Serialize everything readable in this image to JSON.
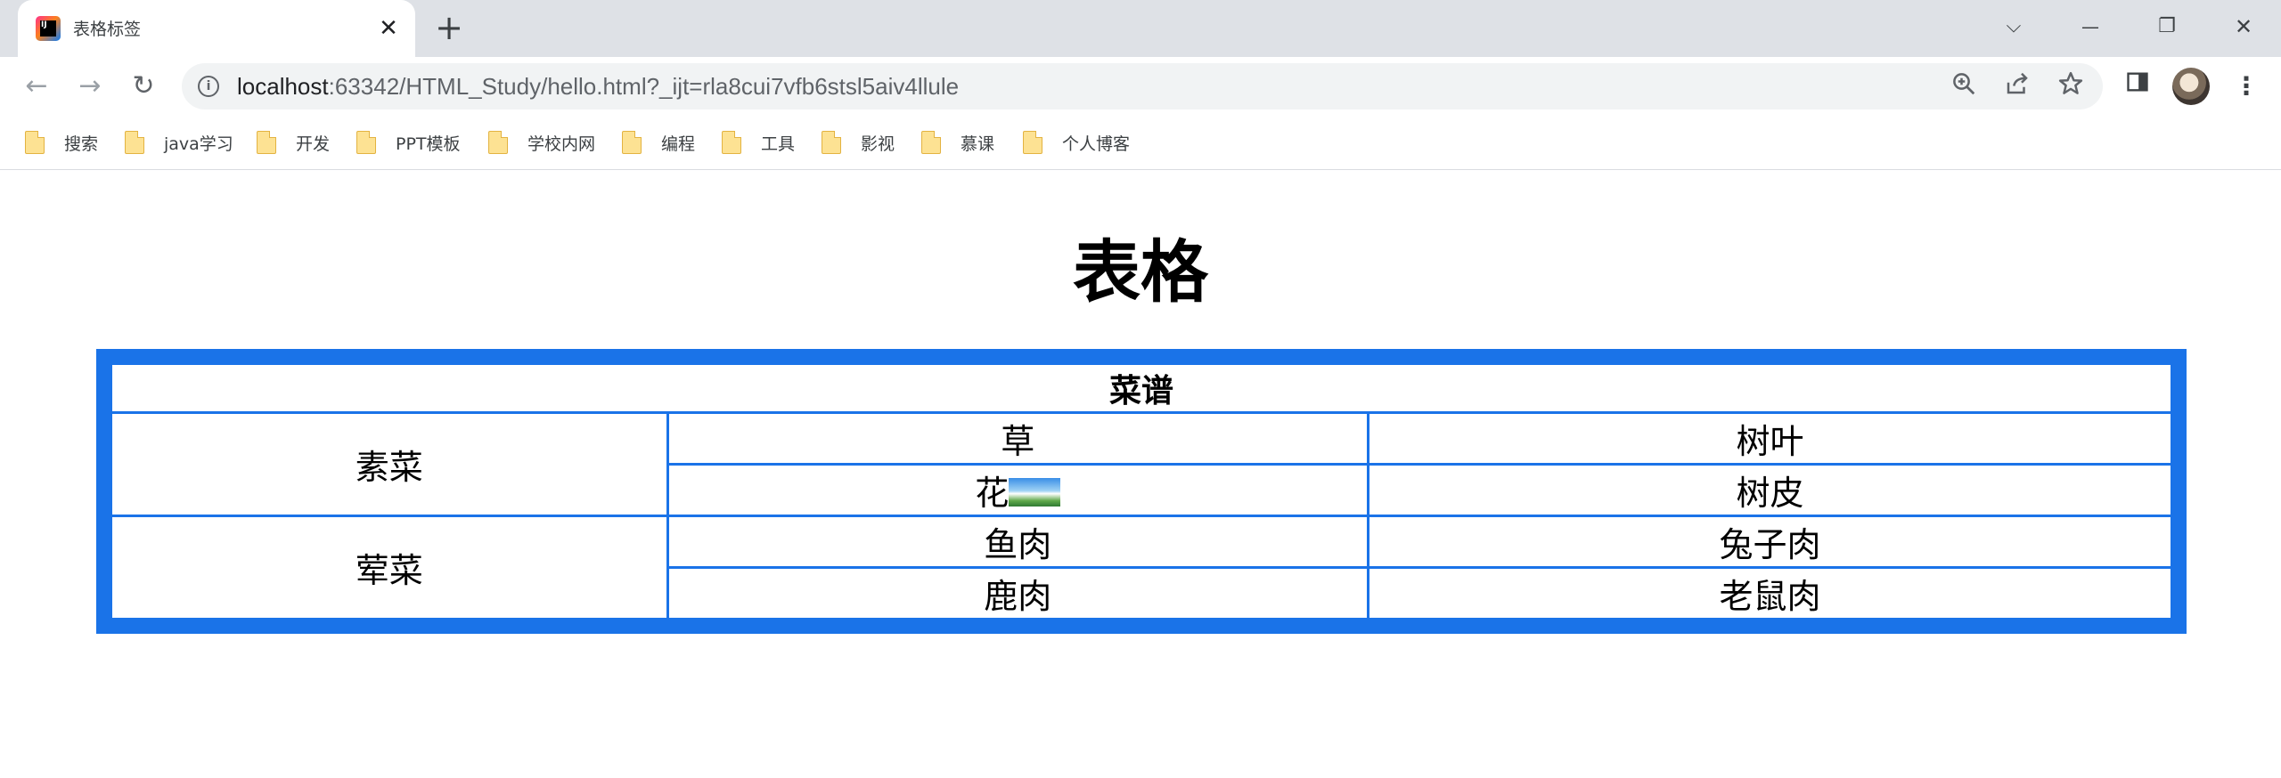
{
  "browser": {
    "tab": {
      "title": "表格标签",
      "close_glyph": "✕"
    },
    "new_tab_glyph": "+",
    "window_controls": {
      "tab_search_glyph": "⌵",
      "minimize_glyph": "—",
      "restore_glyph": "❐",
      "close_glyph": "✕"
    },
    "nav": {
      "back_glyph": "←",
      "forward_glyph": "→",
      "reload_glyph": "↻"
    },
    "url": {
      "host": "localhost",
      "rest": ":63342/HTML_Study/hello.html?_ijt=rla8cui7vfb6stsl5aiv4llule"
    },
    "omnibox_icons": {
      "zoom": "zoom-icon",
      "share": "share-icon",
      "star": "star-icon"
    },
    "toolbar_icons": {
      "side_panel": "side-panel-icon",
      "menu_glyph": "⋮"
    },
    "bookmarks": [
      "搜索",
      "java学习",
      "开发",
      "PPT模板",
      "学校内网",
      "编程",
      "工具",
      "影视",
      "慕课",
      "个人博客"
    ]
  },
  "page": {
    "heading": "表格",
    "table": {
      "caption_row": "菜谱",
      "groups": [
        {
          "label": "素菜",
          "rows": [
            [
              "草",
              "树叶"
            ],
            [
              "花",
              "树皮"
            ]
          ]
        },
        {
          "label": "荤菜",
          "rows": [
            [
              "鱼肉",
              "兔子肉"
            ],
            [
              "鹿肉",
              "老鼠肉"
            ]
          ]
        }
      ]
    }
  }
}
